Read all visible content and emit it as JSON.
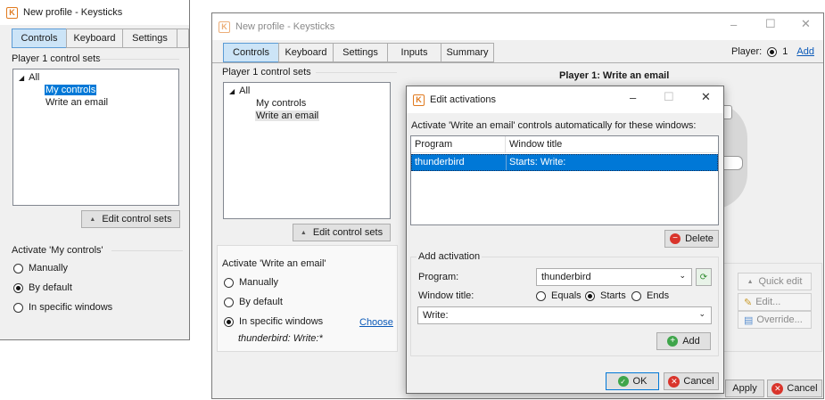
{
  "left": {
    "title": "New profile - Keysticks",
    "tabs": [
      "Controls",
      "Keyboard",
      "Settings"
    ],
    "group_label": "Player 1 control sets",
    "tree": [
      "All",
      "My controls",
      "Write an email"
    ],
    "edit_button": "Edit control sets",
    "activate_label": "Activate 'My controls'",
    "radios": [
      "Manually",
      "By default",
      "In specific windows"
    ]
  },
  "main": {
    "title": "New profile - Keysticks",
    "tabs": [
      "Controls",
      "Keyboard",
      "Settings",
      "Inputs",
      "Summary"
    ],
    "player_label": "Player:",
    "player_value": "1",
    "add_link": "Add",
    "group_label": "Player 1 control sets",
    "tree": [
      "All",
      "My controls",
      "Write an email"
    ],
    "edit_button": "Edit control sets",
    "heading": "Player 1: Write an email",
    "activate_label": "Activate 'Write an email'",
    "radios": [
      "Manually",
      "By default",
      "In specific windows"
    ],
    "choose_link": "Choose",
    "activation_summary": "thunderbird: Write:*",
    "quick_edit": "Quick edit",
    "edit": "Edit...",
    "override": "Override...",
    "apply": "Apply",
    "cancel": "Cancel"
  },
  "dialog": {
    "title": "Edit activations",
    "description": "Activate 'Write an email' controls automatically for these windows:",
    "columns": [
      "Program",
      "Window title"
    ],
    "row": {
      "program": "thunderbird",
      "window": "Starts: Write:"
    },
    "delete": "Delete",
    "add_group": "Add activation",
    "program_label": "Program:",
    "program_value": "thunderbird",
    "window_label": "Window title:",
    "match": [
      "Equals",
      "Starts",
      "Ends"
    ],
    "window_value": "Write:",
    "add": "Add",
    "ok": "OK",
    "cancel": "Cancel"
  }
}
